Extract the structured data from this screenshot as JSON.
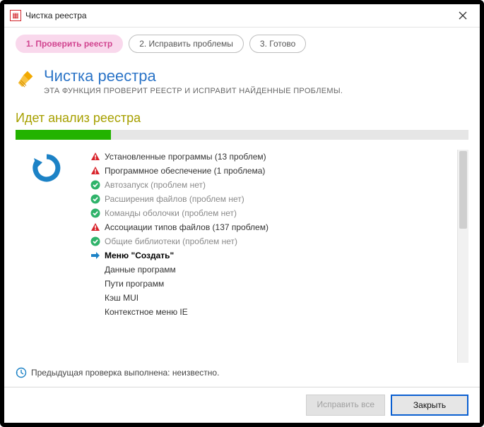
{
  "window": {
    "title": "Чистка реестра"
  },
  "steps": [
    {
      "label": "1. Проверить реестр",
      "active": true
    },
    {
      "label": "2. Исправить проблемы",
      "active": false
    },
    {
      "label": "3. Готово",
      "active": false
    }
  ],
  "header": {
    "title": "Чистка реестра",
    "subtitle": "ЭТА ФУНКЦИЯ ПРОВЕРИТ РЕЕСТР И ИСПРАВИТ НАЙДЕННЫЕ ПРОБЛЕМЫ."
  },
  "status": {
    "text": "Идет анализ реестра",
    "progress_percent": 21
  },
  "scan_items": [
    {
      "icon": "warn",
      "label": "Установленные программы (13 проблем)",
      "state": "problem"
    },
    {
      "icon": "warn",
      "label": "Программное обеспечение (1 проблема)",
      "state": "problem"
    },
    {
      "icon": "ok",
      "label": "Автозапуск (проблем нет)",
      "state": "done"
    },
    {
      "icon": "ok",
      "label": "Расширения файлов (проблем нет)",
      "state": "done"
    },
    {
      "icon": "ok",
      "label": "Команды оболочки (проблем нет)",
      "state": "done"
    },
    {
      "icon": "warn",
      "label": "Ассоциации типов файлов (137 проблем)",
      "state": "problem"
    },
    {
      "icon": "ok",
      "label": "Общие библиотеки (проблем нет)",
      "state": "done"
    },
    {
      "icon": "arrow",
      "label": "Меню \"Создать\"",
      "state": "current"
    },
    {
      "icon": "",
      "label": "Данные программ",
      "state": "pending"
    },
    {
      "icon": "",
      "label": "Пути программ",
      "state": "pending"
    },
    {
      "icon": "",
      "label": "Кэш MUI",
      "state": "pending"
    },
    {
      "icon": "",
      "label": "Контекстное меню IE",
      "state": "pending"
    }
  ],
  "previous_check": "Предыдущая проверка выполнена: неизвестно.",
  "buttons": {
    "fix_all": "Исправить все",
    "close": "Закрыть"
  }
}
